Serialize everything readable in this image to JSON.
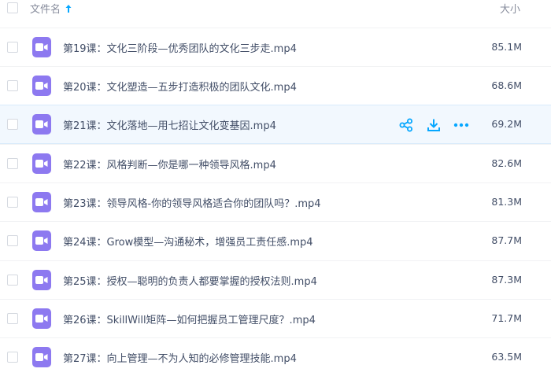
{
  "header": {
    "name_label": "文件名",
    "size_label": "大小"
  },
  "files": [
    {
      "name": "第19课：文化三阶段—优秀团队的文化三步走.mp4",
      "size": "85.1M"
    },
    {
      "name": "第20课：文化塑造—五步打造积极的团队文化.mp4",
      "size": "68.6M"
    },
    {
      "name": "第21课：文化落地—用七招让文化变基因.mp4",
      "size": "69.2M"
    },
    {
      "name": "第22课：风格判断—你是哪一种领导风格.mp4",
      "size": "82.6M"
    },
    {
      "name": "第23课：领导风格-你的领导风格适合你的团队吗？.mp4",
      "size": "81.3M"
    },
    {
      "name": "第24课：Grow模型—沟通秘术，增强员工责任感.mp4",
      "size": "87.7M"
    },
    {
      "name": "第25课：授权—聪明的负责人都要掌握的授权法则.mp4",
      "size": "87.3M"
    },
    {
      "name": "第26课：SkillWill矩阵—如何把握员工管理尺度？.mp4",
      "size": "71.7M"
    },
    {
      "name": "第27课：向上管理—不为人知的必修管理技能.mp4",
      "size": "63.5M"
    }
  ],
  "hovered_row_actions": [
    "share-icon",
    "download-icon",
    "more-icon"
  ],
  "colors": {
    "accent": "#06a7ff",
    "video_icon": "#8d79f0",
    "hover_bg": "#f2f8fe"
  }
}
